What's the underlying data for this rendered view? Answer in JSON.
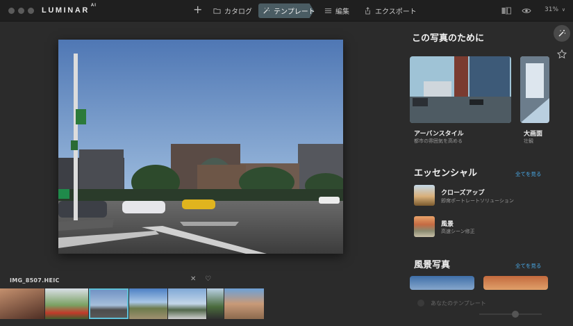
{
  "app": {
    "name": "LUMINAR",
    "suffix": "AI"
  },
  "nav": {
    "catalog": "カタログ",
    "templates": "テンプレート",
    "edit": "編集",
    "export": "エクスポート",
    "zoom": "31%"
  },
  "file": {
    "name": "IMG_8507.HEIC"
  },
  "panel": {
    "for_this_photo": "この写真のために",
    "cards": [
      {
        "title": "アーバンスタイル",
        "subtitle": "都市の雰囲気を高める"
      },
      {
        "title": "大画面",
        "subtitle": "壮観"
      }
    ],
    "essentials": {
      "title": "エッセンシャル",
      "see_all": "全てを見る",
      "items": [
        {
          "title": "クローズアップ",
          "subtitle": "即席ポートレートソリューション"
        },
        {
          "title": "風景",
          "subtitle": "高速シーン修正"
        }
      ]
    },
    "landscape": {
      "title": "風景写真",
      "see_all": "全てを見る"
    },
    "your_templates": "あなたのテンプレート"
  },
  "icons": {
    "traffic": [
      "traffic-light-icon",
      "traffic-light-icon",
      "traffic-light-icon"
    ],
    "add": "plus-icon",
    "catalog": "folder-icon",
    "templates": "magic-wand-icon",
    "edit": "sliders-icon",
    "export": "share-icon",
    "compare": "compare-icon",
    "view": "eye-icon",
    "chevron": "chevron-down-icon",
    "close": "close-icon",
    "favorite": "heart-icon",
    "star": "star-icon"
  },
  "colors": {
    "accent": "#49a8e6",
    "active_tab": "#4a5c63",
    "selection": "#5fc0d8"
  }
}
